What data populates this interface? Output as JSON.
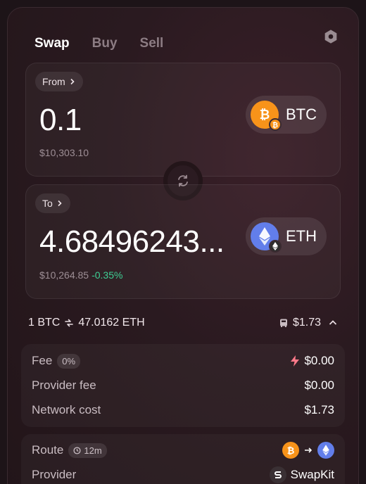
{
  "tabs": [
    {
      "label": "Swap",
      "active": true
    },
    {
      "label": "Buy",
      "active": false
    },
    {
      "label": "Sell",
      "active": false
    }
  ],
  "from": {
    "label": "From",
    "amount": "0.1",
    "fiat": "$10,303.10",
    "token": {
      "symbol": "BTC",
      "icon": "bitcoin-icon",
      "color": "#f7931a"
    }
  },
  "to": {
    "label": "To",
    "amount": "4.68496243...",
    "fiat": "$10,264.85",
    "change": "-0.35%",
    "token": {
      "symbol": "ETH",
      "icon": "ethereum-icon",
      "color": "#627eea"
    }
  },
  "rate": {
    "left": "1 BTC",
    "right": "47.0162 ETH",
    "total_fee": "$1.73"
  },
  "fees": {
    "fee_label": "Fee",
    "fee_badge": "0%",
    "fee_value": "$0.00",
    "provider_fee_label": "Provider fee",
    "provider_fee_value": "$0.00",
    "network_cost_label": "Network cost",
    "network_cost_value": "$1.73"
  },
  "route": {
    "route_label": "Route",
    "route_time": "12m",
    "provider_label": "Provider",
    "provider_name": "SwapKit"
  },
  "colors": {
    "accent_positive": "#3ecf94",
    "fee_flash": "#ff7a8a"
  }
}
